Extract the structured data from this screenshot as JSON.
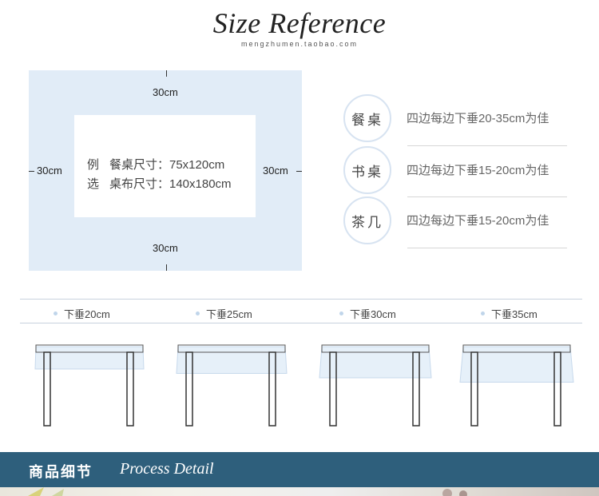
{
  "header": {
    "title": "Size Reference",
    "subtitle": "mengzhumen.taobao.com"
  },
  "diagram": {
    "top": "30cm",
    "bottom": "30cm",
    "left": "30cm",
    "right": "30cm",
    "example": {
      "prefix1": "例",
      "line1": "餐桌尺寸：75x120cm",
      "prefix2": "选",
      "line2": "桌布尺寸：140x180cm"
    }
  },
  "guide": [
    {
      "name": "餐桌",
      "text": "四边每边下垂20-35cm为佳"
    },
    {
      "name": "书桌",
      "text": "四边每边下垂15-20cm为佳"
    },
    {
      "name": "茶几",
      "text": "四边每边下垂15-20cm为佳"
    }
  ],
  "drops": [
    {
      "label": "下垂20cm",
      "drop_cm": 20
    },
    {
      "label": "下垂25cm",
      "drop_cm": 25
    },
    {
      "label": "下垂30cm",
      "drop_cm": 30
    },
    {
      "label": "下垂35cm",
      "drop_cm": 35
    }
  ],
  "footer": {
    "cn": "商品细节",
    "en": "Process Detail"
  },
  "colors": {
    "diagram_bg": "#e1ecf7",
    "footer_bg": "#2e5f7c",
    "cloth": "#e6f0f9",
    "table_leg": "#333333"
  }
}
